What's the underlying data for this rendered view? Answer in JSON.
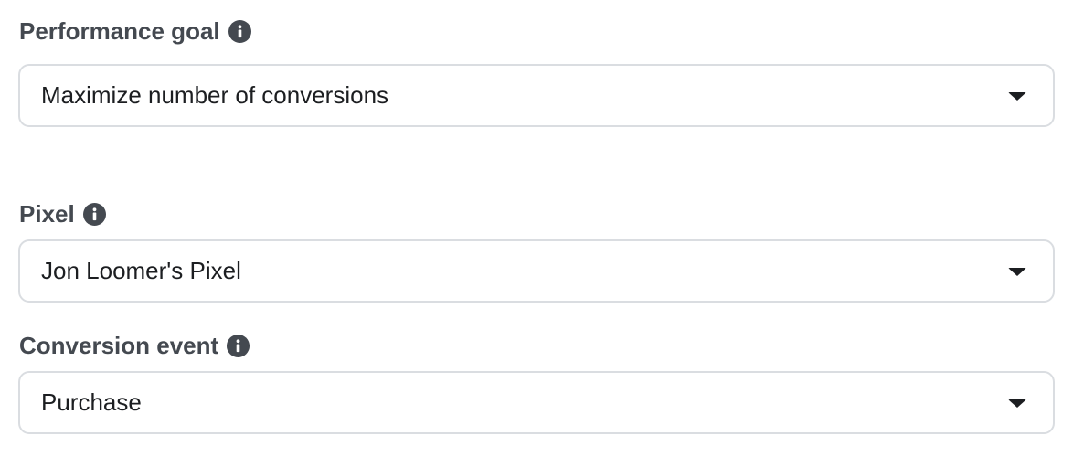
{
  "performance_goal": {
    "label": "Performance goal",
    "value": "Maximize number of conversions"
  },
  "pixel": {
    "label": "Pixel",
    "value": "Jon Loomer's Pixel"
  },
  "conversion_event": {
    "label": "Conversion event",
    "value": "Purchase"
  },
  "icons": {
    "info": "info-icon",
    "dropdown": "chevron-down-icon"
  },
  "colors": {
    "label_text": "#444950",
    "value_text": "#1c1e21",
    "border": "#dadde1",
    "background": "#ffffff"
  }
}
